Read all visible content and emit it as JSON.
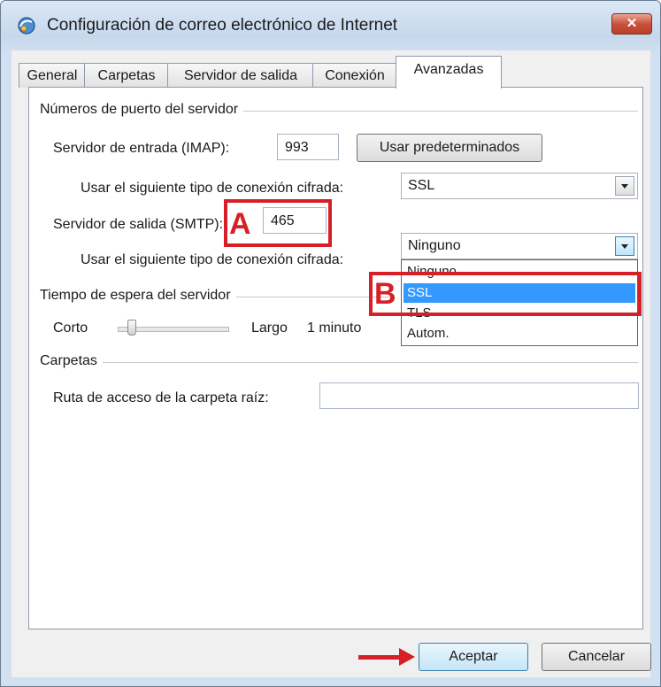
{
  "window": {
    "title": "Configuración de correo electrónico de Internet",
    "close_label": "✕"
  },
  "tabs": [
    {
      "label": "General"
    },
    {
      "label": "Carpetas"
    },
    {
      "label": "Servidor de salida"
    },
    {
      "label": "Conexión"
    },
    {
      "label": "Avanzadas"
    }
  ],
  "ports": {
    "group_label": "Números de puerto del servidor",
    "incoming_label": "Servidor de entrada (IMAP):",
    "incoming_value": "993",
    "defaults_button": "Usar predeterminados",
    "incoming_encryption_label": "Usar el siguiente tipo de conexión cifrada:",
    "incoming_encryption_value": "SSL",
    "outgoing_label": "Servidor de salida (SMTP):",
    "outgoing_value": "465",
    "outgoing_encryption_label": "Usar el siguiente tipo de conexión cifrada:",
    "outgoing_encryption_value": "Ninguno",
    "outgoing_encryption_options": [
      "Ninguno",
      "SSL",
      "TLS",
      "Autom."
    ],
    "highlighted_option": "SSL"
  },
  "timeout": {
    "group_label": "Tiempo de espera del servidor",
    "short_label": "Corto",
    "long_label": "Largo",
    "value_label": "1 minuto"
  },
  "folders": {
    "group_label": "Carpetas",
    "root_path_label": "Ruta de acceso de la carpeta raíz:",
    "root_path_value": ""
  },
  "buttons": {
    "ok": "Aceptar",
    "cancel": "Cancelar"
  },
  "annotations": {
    "a": "A",
    "b": "B",
    "color": "#d61f26"
  },
  "colors": {
    "selection": "#3399ff",
    "titlebar": "#c6d8ec",
    "close": "#c9523c"
  }
}
